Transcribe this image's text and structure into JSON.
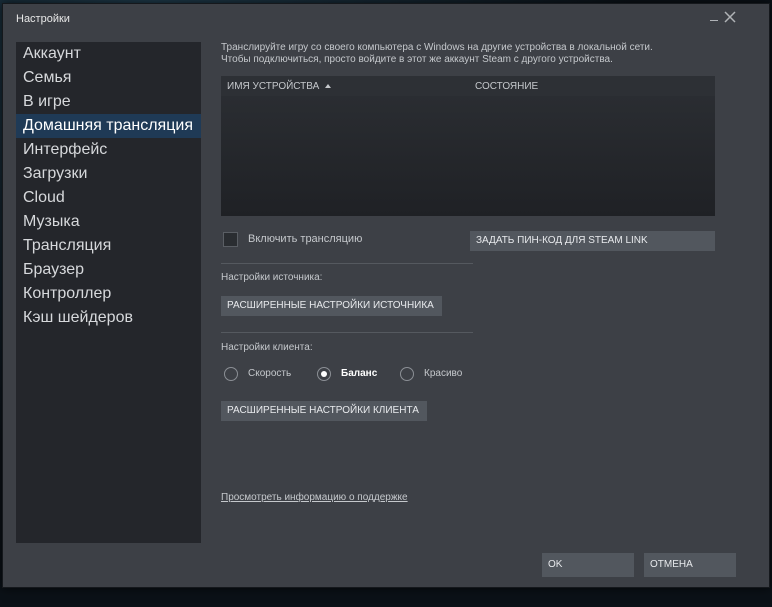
{
  "window": {
    "title": "Настройки"
  },
  "sidebar": {
    "items": [
      {
        "label": "Аккаунт"
      },
      {
        "label": "Семья"
      },
      {
        "label": "В игре"
      },
      {
        "label": "Домашняя трансляция",
        "selected": true
      },
      {
        "label": "Интерфейс"
      },
      {
        "label": "Загрузки"
      },
      {
        "label": "Cloud"
      },
      {
        "label": "Музыка"
      },
      {
        "label": "Трансляция"
      },
      {
        "label": "Браузер"
      },
      {
        "label": "Контроллер"
      },
      {
        "label": "Кэш шейдеров"
      }
    ]
  },
  "main": {
    "intro_line1": "Транслируйте игру со своего компьютера с Windows на другие устройства в локальной сети.",
    "intro_line2": "Чтобы подключиться, просто войдите в этот же аккаунт Steam с другого устройства.",
    "table": {
      "col_device": "ИМЯ УСТРОЙСТВА",
      "col_state": "СОСТОЯНИЕ",
      "sort": "ascending",
      "rows": []
    },
    "enable_streaming": {
      "label": "Включить трансляцию",
      "checked": false
    },
    "pin_button": "ЗАДАТЬ ПИН-КОД ДЛЯ STEAM LINK",
    "source_label": "Настройки источника:",
    "source_advanced_button": "РАСШИРЕННЫЕ НАСТРОЙКИ ИСТОЧНИКА",
    "client_label": "Настройки клиента:",
    "client_options": [
      {
        "label": "Скорость",
        "selected": false
      },
      {
        "label": "Баланс",
        "selected": true
      },
      {
        "label": "Красиво",
        "selected": false
      }
    ],
    "client_advanced_button": "РАСШИРЕННЫЕ НАСТРОЙКИ КЛИЕНТА",
    "support_link": "Просмотреть информацию о поддержке"
  },
  "footer": {
    "ok_label": "OK",
    "cancel_label": "ОТМЕНА"
  },
  "colors": {
    "window_bg": "#3d4046",
    "sidebar_bg": "#24262b",
    "selected_bg": "#1f3a56",
    "button_bg": "#52575e"
  },
  "icons": {
    "minimize": "minimize-icon",
    "close": "close-icon",
    "sort": "sort-ascending-icon"
  }
}
